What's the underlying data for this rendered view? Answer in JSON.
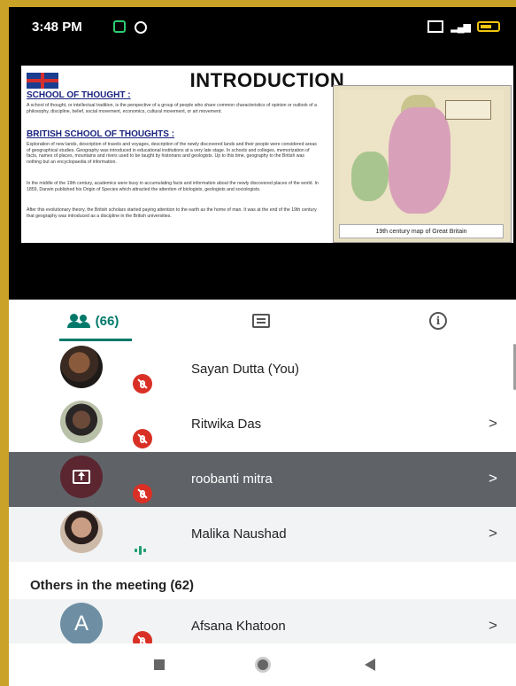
{
  "status_bar": {
    "time": "3:48 PM"
  },
  "slide": {
    "title": "INTRODUCTION",
    "section1_heading": "SCHOOL OF THOUGHT :",
    "section1_text": "A school of thought, or intellectual tradition, is the perspective of a group of people who share common characteristics of opinion or outlook of a philosophy, discipline, belief, social movement, economics, cultural movement, or art movement.",
    "section2_heading": "BRITISH SCHOOL OF THOUGHTS :",
    "section2_text1": "Exploration of new lands, description of travels and voyages, description of the newly discovered lands and their people were considered areas of geographical studies. Geography was introduced in educational institutions at a very late stage. In schools and colleges, memorization of facts, names of places, mountains and rivers used to be taught by historians and geologists. Up to this time, geography to the British was nothing but an encyclopaedia of information.",
    "section2_text2": "In the middle of the 19th century, academics were busy in accumulating facts and information about the newly discovered places of the world. In 1859, Darwin published his Origin of Species which attracted the attention of biologists, geologists and sociologists.",
    "section2_text3": "After this evolutionary theory, the British scholars started paying attention to the earth as the home of man. It was at the end of the 19th century that geography was introduced as a discipline in the British universities.",
    "map_caption": "19th century map of Great Britain"
  },
  "tabs": {
    "people_count": "(66)"
  },
  "participants": [
    {
      "name": "Sayan Dutta (You)",
      "status": "muted"
    },
    {
      "name": "Ritwika Das",
      "status": "muted"
    },
    {
      "name": "roobanti mitra",
      "status": "muted",
      "presenting": true
    },
    {
      "name": "Malika Naushad",
      "status": "speaking"
    }
  ],
  "others": {
    "header": "Others in the meeting (62)",
    "items": [
      {
        "name": "Afsana Khatoon",
        "initial": "A",
        "status": "muted"
      }
    ]
  },
  "icons": {
    "people_tab": "people-icon",
    "chat_tab": "chat-icon",
    "info_tab": "info-icon",
    "mute": "mic-off-icon",
    "present": "present-screen-icon",
    "chevron": "chevron-right-icon"
  },
  "colors": {
    "accent": "#00796b",
    "mute_red": "#d93025",
    "highlight_row": "#5f6368",
    "speaking_green": "#1e9e6e"
  }
}
